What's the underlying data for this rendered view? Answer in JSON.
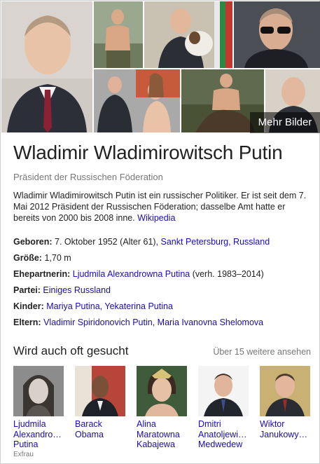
{
  "images": {
    "more_label": "Mehr Bilder",
    "tiles": [
      {
        "name": "portrait",
        "icon": "person-photo"
      },
      {
        "name": "shirtless-fishing",
        "icon": "person-photo"
      },
      {
        "name": "with-dog",
        "icon": "person-photo"
      },
      {
        "name": "sunglasses",
        "icon": "person-photo"
      },
      {
        "name": "with-protester",
        "icon": "person-photo"
      },
      {
        "name": "shirtless-horse",
        "icon": "person-photo"
      },
      {
        "name": "portrait-2",
        "icon": "person-photo"
      }
    ]
  },
  "entity": {
    "title": "Wladimir Wladimirowitsch Putin",
    "subtitle": "Präsident der Russischen Föderation",
    "description": "Wladimir Wladimirowitsch Putin ist ein russischer Politiker. Er ist seit dem 7. Mai 2012 Präsident der Russischen Föderation; dasselbe Amt hatte er bereits von 2000 bis 2008 inne. ",
    "source_link": "Wikipedia"
  },
  "facts": {
    "born_label": "Geboren:",
    "born_value": " 7. Oktober 1952 (Alter 61), ",
    "born_place": "Sankt Petersburg, Russland",
    "height_label": "Größe:",
    "height_value": " 1,70 m",
    "spouse_label": "Ehepartnerin:",
    "spouse_link": "Ljudmila Alexandrowna Putina",
    "spouse_extra": " (verh. 1983–2014)",
    "party_label": "Partei:",
    "party_link": "Einiges Russland",
    "children_label": "Kinder:",
    "children_link": "Mariya Putina, Yekaterina Putina",
    "parents_label": "Eltern:",
    "parents_link": "Vladimir Spiridonovich Putin, Maria Ivanovna Shelomova"
  },
  "people_also": {
    "title": "Wird auch oft gesucht",
    "more": "Über 15 weitere ansehen",
    "items": [
      {
        "line1": "Ljudmila",
        "line2": "Alexandro…",
        "line3": "Putina",
        "role": "Exfrau"
      },
      {
        "line1": "Barack",
        "line2": "Obama",
        "line3": "",
        "role": ""
      },
      {
        "line1": "Alina",
        "line2": "Maratowna",
        "line3": "Kabajewa",
        "role": ""
      },
      {
        "line1": "Dmitri",
        "line2": "Anatoljewi…",
        "line3": "Medwedew",
        "role": ""
      },
      {
        "line1": "Wiktor",
        "line2": "Janukowy…",
        "line3": "",
        "role": ""
      }
    ]
  }
}
